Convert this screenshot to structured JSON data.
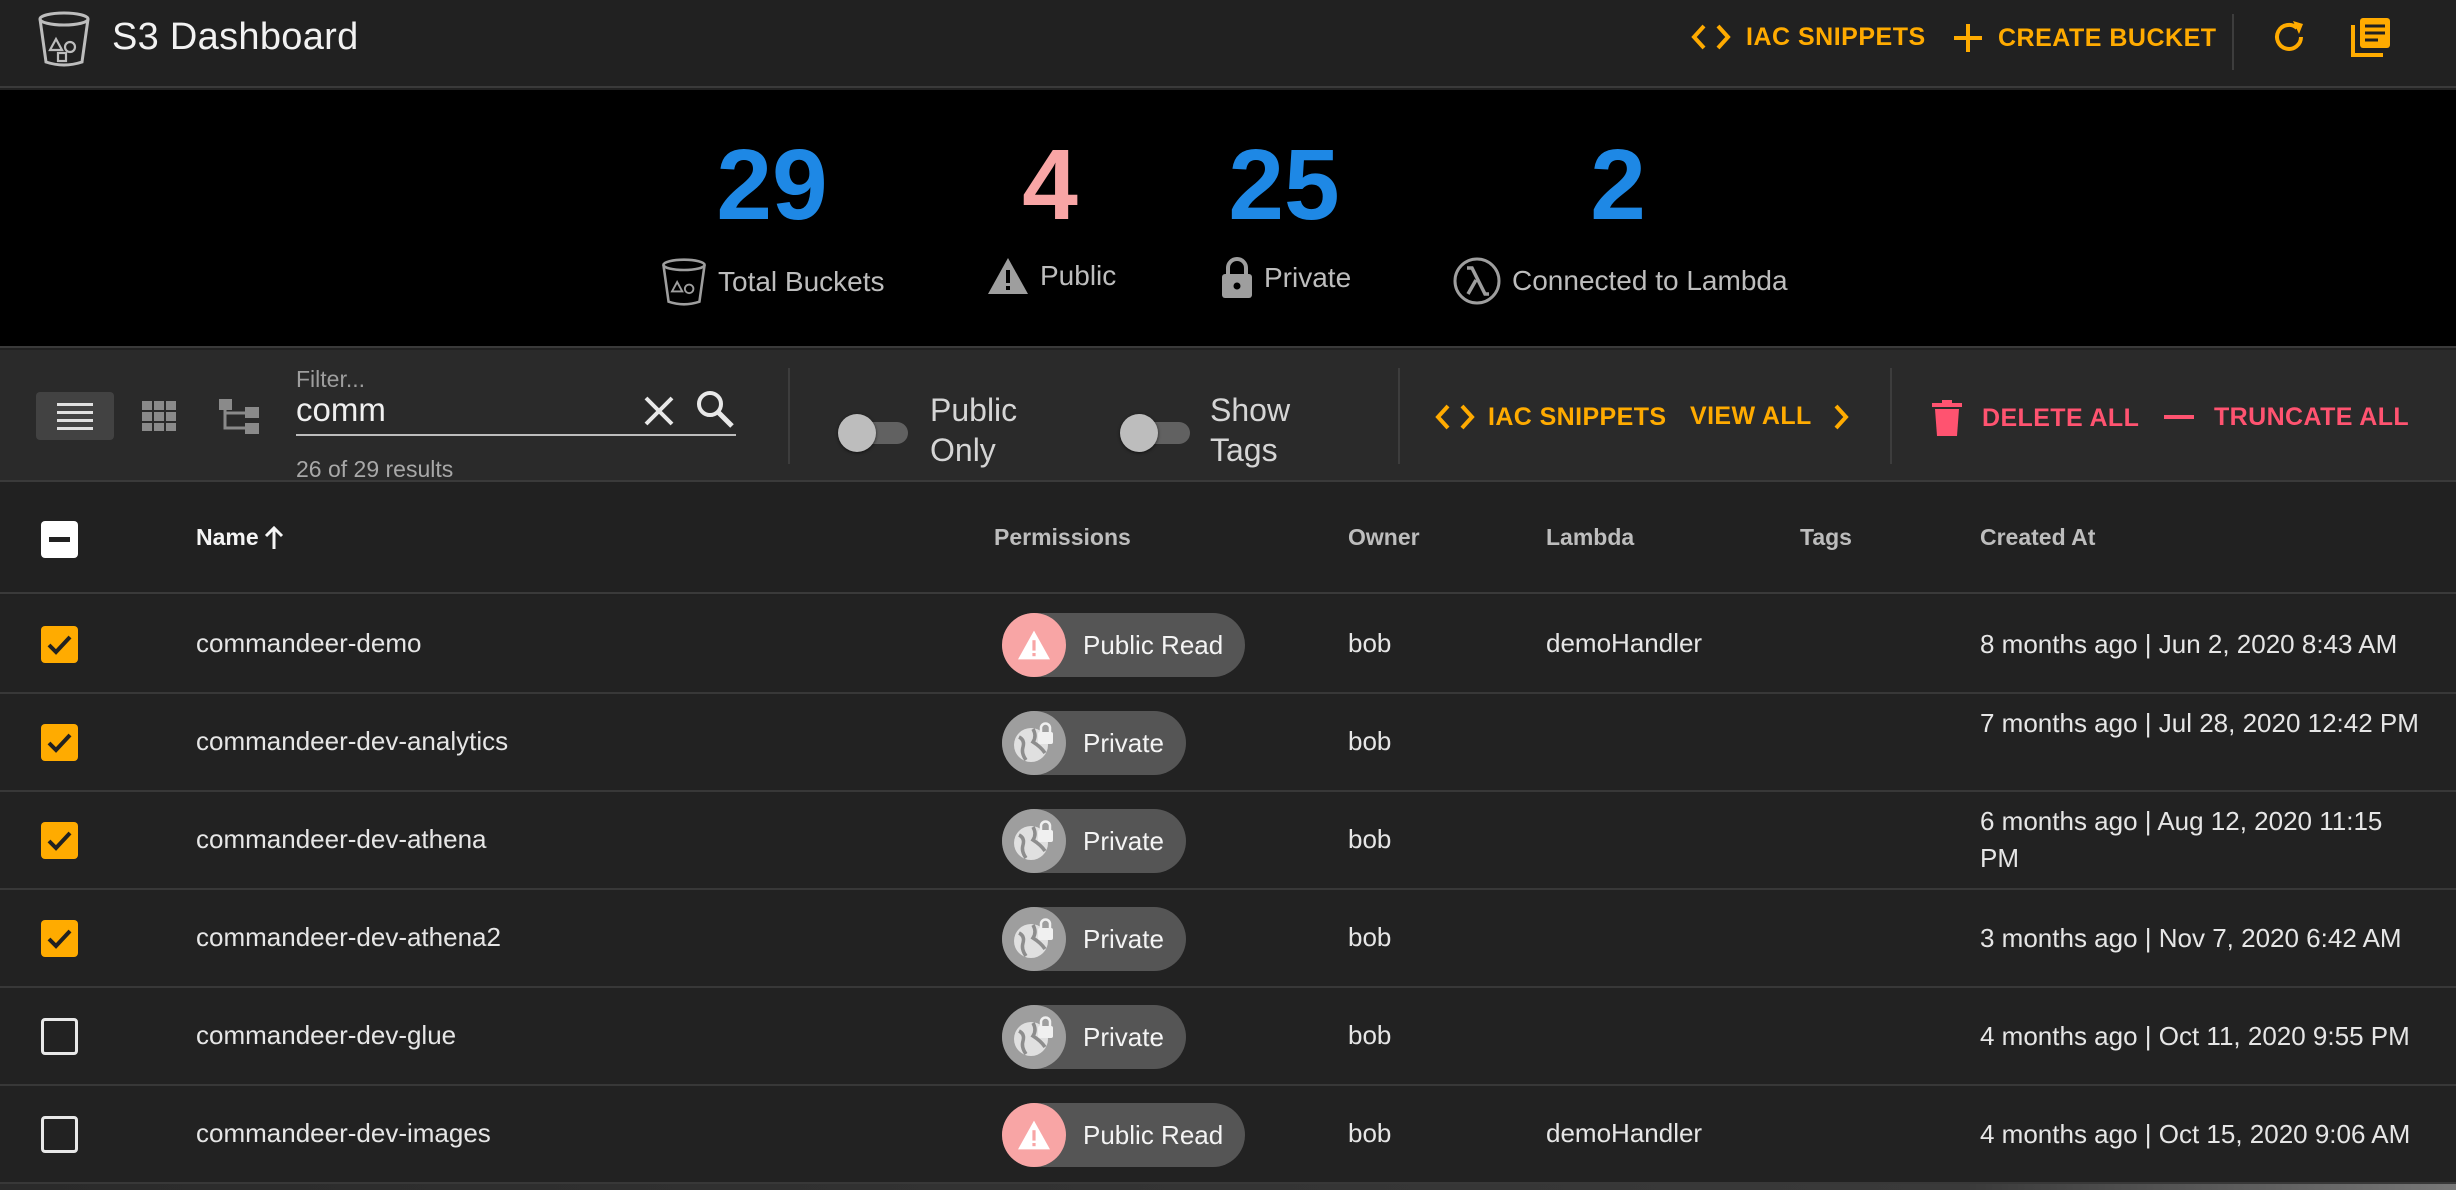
{
  "header": {
    "title": "S3 Dashboard",
    "actions": {
      "iac_snippets": "IAC SNIPPETS",
      "create_bucket": "CREATE BUCKET"
    }
  },
  "stats": [
    {
      "value": "29",
      "label": "Total Buckets",
      "color": "#1e88e5",
      "icon": "bucket-icon"
    },
    {
      "value": "4",
      "label": "Public",
      "color": "#f8a5a5",
      "icon": "warning-icon"
    },
    {
      "value": "25",
      "label": "Private",
      "color": "#1e88e5",
      "icon": "lock-icon"
    },
    {
      "value": "2",
      "label": "Connected to Lambda",
      "color": "#1e88e5",
      "icon": "lambda-icon"
    }
  ],
  "toolbar": {
    "filter_placeholder": "Filter...",
    "filter_value": "comm",
    "results": "26 of 29 results",
    "public_only": "Public Only",
    "show_tags": "Show Tags",
    "iac_snippets": "IAC SNIPPETS",
    "view_all": "VIEW ALL",
    "delete_all": "DELETE ALL",
    "truncate_all": "TRUNCATE ALL"
  },
  "table": {
    "columns": {
      "name": "Name",
      "permissions": "Permissions",
      "owner": "Owner",
      "lambda": "Lambda",
      "tags": "Tags",
      "created": "Created At"
    },
    "rows": [
      {
        "checked": true,
        "name": "commandeer-demo",
        "permission": "Public Read",
        "owner": "bob",
        "lambda": "demoHandler",
        "tags": "",
        "created": "8 months ago | Jun 2, 2020 8:43 AM"
      },
      {
        "checked": true,
        "name": "commandeer-dev-analytics",
        "permission": "Private",
        "owner": "bob",
        "lambda": "",
        "tags": "",
        "created": "7 months ago | Jul 28, 2020 12:42 PM"
      },
      {
        "checked": true,
        "name": "commandeer-dev-athena",
        "permission": "Private",
        "owner": "bob",
        "lambda": "",
        "tags": "",
        "created": "6 months ago | Aug 12, 2020 11:15 PM"
      },
      {
        "checked": true,
        "name": "commandeer-dev-athena2",
        "permission": "Private",
        "owner": "bob",
        "lambda": "",
        "tags": "",
        "created": "3 months ago | Nov 7, 2020 6:42 AM"
      },
      {
        "checked": false,
        "name": "commandeer-dev-glue",
        "permission": "Private",
        "owner": "bob",
        "lambda": "",
        "tags": "",
        "created": "4 months ago | Oct 11, 2020 9:55 PM"
      },
      {
        "checked": false,
        "name": "commandeer-dev-images",
        "permission": "Public Read",
        "owner": "bob",
        "lambda": "demoHandler",
        "tags": "",
        "created": "4 months ago | Oct 15, 2020 9:06 AM"
      }
    ]
  },
  "colors": {
    "accent": "#ffab00",
    "danger": "#ff5370",
    "stat_blue": "#1e88e5",
    "public_pink": "#f8a5a5"
  }
}
